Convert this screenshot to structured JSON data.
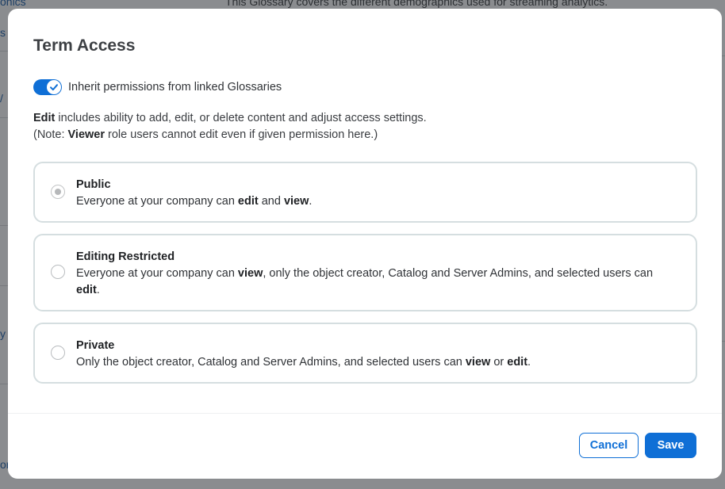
{
  "background": {
    "fragments": [
      "onics",
      "s",
      "/",
      "y",
      "or"
    ],
    "description": "This Glossary covers the different demographics used for streaming analytics."
  },
  "modal": {
    "title": "Term Access",
    "inherit_toggle": {
      "label": "Inherit permissions from linked Glossaries",
      "checked": true
    },
    "help": {
      "line1_bold": "Edit",
      "line1_rest": " includes ability to add, edit, or delete content and adjust access settings.",
      "line2_pre": "(Note: ",
      "line2_bold": "Viewer",
      "line2_rest": " role users cannot edit even if given permission here.)"
    },
    "options": [
      {
        "title": "Public",
        "selected": true,
        "desc_parts": [
          "Everyone at your company can ",
          "edit",
          " and ",
          "view",
          "."
        ]
      },
      {
        "title": "Editing Restricted",
        "selected": false,
        "desc_parts": [
          "Everyone at your company can ",
          "view",
          ", only the object creator, Catalog and Server Admins, and selected users can ",
          "edit",
          "."
        ]
      },
      {
        "title": "Private",
        "selected": false,
        "desc_parts": [
          "Only the object creator, Catalog and Server Admins, and selected users can ",
          "view",
          " or ",
          "edit",
          "."
        ]
      }
    ],
    "buttons": {
      "cancel": "Cancel",
      "save": "Save"
    }
  },
  "colors": {
    "accent": "#0f6fd6",
    "overlay": "#8a8c8f",
    "option_border": "#d5dee0"
  }
}
